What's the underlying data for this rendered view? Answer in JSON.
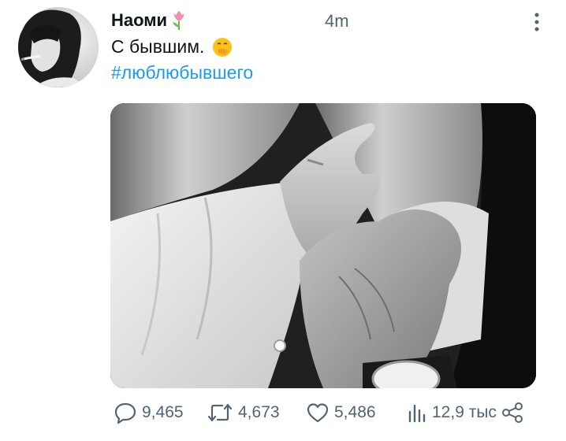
{
  "tweet": {
    "author": {
      "display_name": "Наоми",
      "name_emoji": "tulip"
    },
    "timestamp": "4m",
    "text": "С бывшим.",
    "text_emoji": "face-with-hand-over-mouth",
    "hashtag": "#люблюбывшего",
    "media": {
      "description_icon": "photo"
    }
  },
  "actions": {
    "replies": "9,465",
    "retweets": "4,673",
    "likes": "5,486",
    "views": "12,9 тыс"
  },
  "colors": {
    "text_primary": "#0f1419",
    "text_secondary": "#536471",
    "link": "#1d9bf0"
  }
}
